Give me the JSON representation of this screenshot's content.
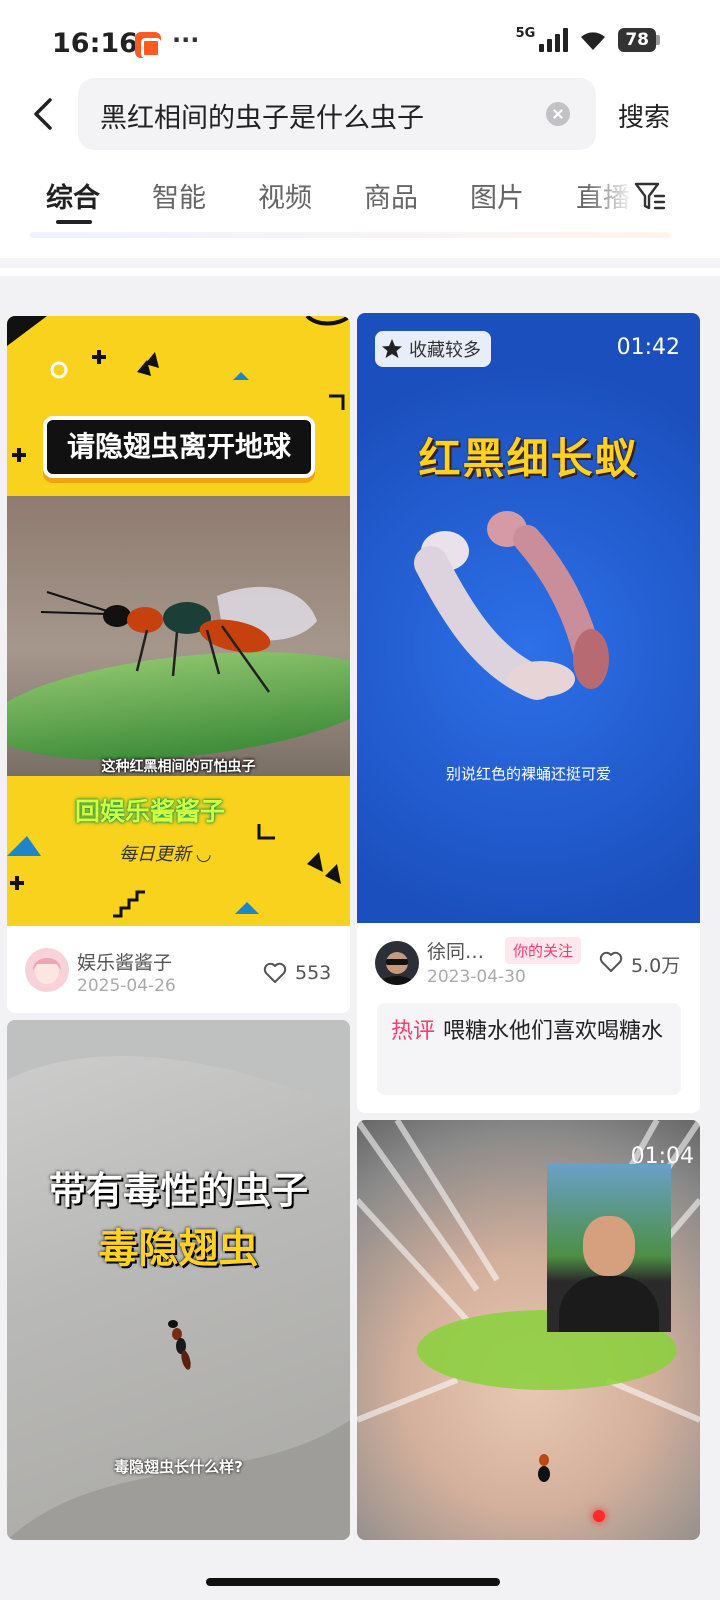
{
  "status_bar": {
    "time": "16:16",
    "network": "5G",
    "battery": "78",
    "app_icon": "kuaishou-icon",
    "more_glyph": "···"
  },
  "search": {
    "query": "黑红相间的虫子是什么虫子",
    "submit_label": "搜索",
    "back_icon": "back-arrow-icon",
    "clear_icon": "clear-icon"
  },
  "tabs": [
    {
      "label": "综合",
      "active": true
    },
    {
      "label": "智能"
    },
    {
      "label": "视频"
    },
    {
      "label": "商品"
    },
    {
      "label": "图片"
    },
    {
      "label": "直播"
    }
  ],
  "filter_icon": "filter-icon",
  "results": [
    {
      "thumb_banner": "请隐翅虫离开地球",
      "thumb_caption": "这种红黑相间的可怕虫子",
      "thumb_logo": "回娱乐酱酱子",
      "thumb_script": "每日更新 ◡",
      "author": "娱乐酱酱子",
      "date": "2025-04-26",
      "likes": "553"
    },
    {
      "badge": "收藏较多",
      "duration": "01:42",
      "thumb_title": "红黑细长蚁",
      "thumb_caption": "别说红色的裸蛹还挺可爱",
      "author": "徐同…",
      "follow_badge": "你的关注",
      "date": "2023-04-30",
      "likes": "5.0万",
      "hot_label": "热评",
      "hot_comment": "喂糖水他们喜欢喝糖水"
    },
    {
      "thumb_line1": "带有毒性的虫子",
      "thumb_line2": "毒隐翅虫",
      "thumb_caption": "毒隐翅虫长什么样?"
    },
    {
      "duration": "01:04"
    }
  ],
  "colors": {
    "accent_pink": "#ff3b6b",
    "card1_yellow": "#f8d21c",
    "card2_blue": "#1b4fbd"
  }
}
